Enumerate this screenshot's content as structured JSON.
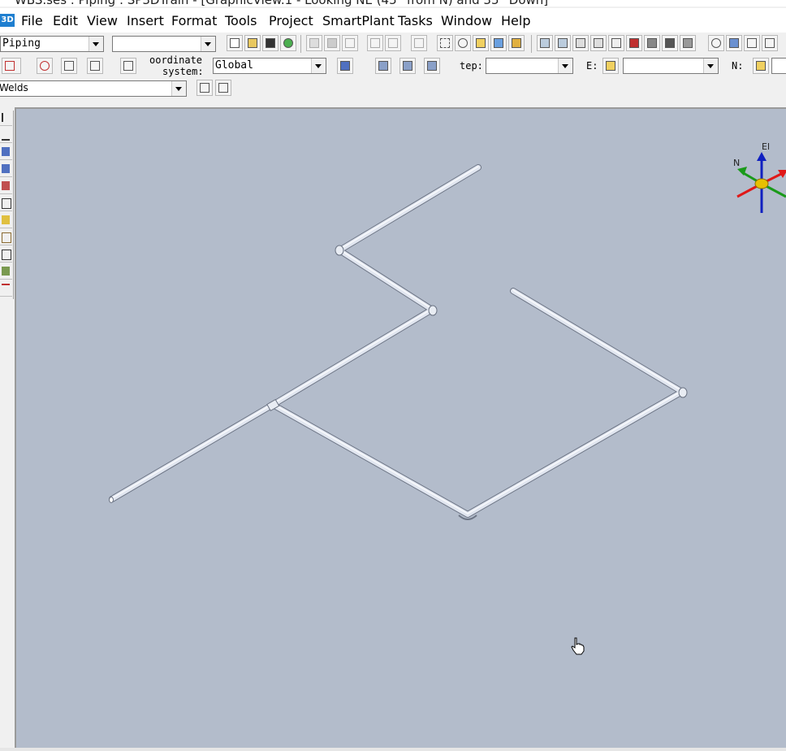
{
  "window": {
    "title": "WBS.ses : Piping : SP3DTrain - [GraphicView.1 - Looking NE (45° from N) and 35° Down]",
    "app_icon_text": "3D"
  },
  "menu": [
    "File",
    "Edit",
    "View",
    "Insert",
    "Format",
    "Tools",
    "Project",
    "SmartPlant",
    "Tasks",
    "Window",
    "Help"
  ],
  "toolbar1": {
    "task_combo": "Piping",
    "second_combo": ""
  },
  "toolbar2": {
    "coordinate_label_line1": "oordinate",
    "coordinate_label_line2": "system:",
    "coordinate_value": "Global",
    "step_label": "tep:",
    "step_value": "",
    "e_label": "E:",
    "e_value": "",
    "n_label": "N:"
  },
  "toolbar3": {
    "filter_combo": "Welds"
  },
  "compass": {
    "up_label": "El",
    "north_label": "N",
    "colors": {
      "north": "#1a9a1a",
      "east": "#e01818",
      "elevation": "#1020c0",
      "center": "#e8c000"
    }
  },
  "viewport": {
    "background": "#b3bccb",
    "pipe_color": "#dde3ef"
  }
}
